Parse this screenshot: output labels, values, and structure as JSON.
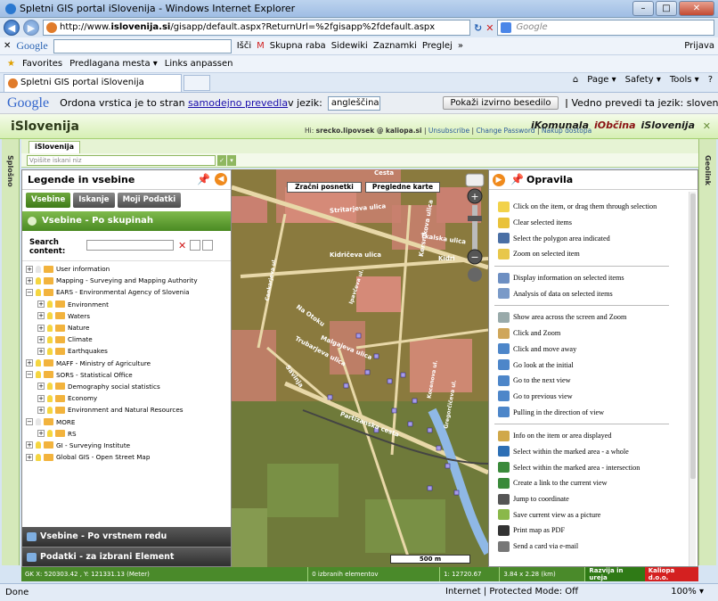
{
  "window": {
    "title": "Spletni GIS portal iSlovenija - Windows Internet Explorer"
  },
  "browser": {
    "address_prefix": "http://www.",
    "address_domain": "islovenija.si",
    "address_rest": "/gisapp/default.aspx?ReturnUrl=%2fgisapp%2fdefault.aspx",
    "search_placeholder": "Google",
    "google_label": "Google",
    "google_items": [
      "Išči",
      "M",
      "Skupna raba",
      "Sidewiki",
      "Zaznamki",
      "Preglej",
      "»",
      "Prijava"
    ],
    "favorites_label": "Favorites",
    "fav_items": [
      "Predlagana mesta ▾",
      "Links anpassen"
    ],
    "tab_label": "Spletni GIS portal iSlovenija",
    "cmd_items": [
      "Page ▾",
      "Safety ▾",
      "Tools ▾"
    ]
  },
  "translate": {
    "logo": "Google",
    "text_a": "Ordona vrstica je to stran ",
    "link": "samodejno prevedla",
    "text_b": " v jezik:",
    "language": "angleščina",
    "button": "Pokaži izvirno besedilo",
    "always": "Vedno prevedi ta jezik: slovenščina",
    "close": "✕"
  },
  "app": {
    "brand": "iSlovenija",
    "user_prefix": "Hi: ",
    "user": "srecko.lipovsek @ kaliopa.si",
    "unsubscribe": "Unsubscribe",
    "change_password": "Change Password",
    "buy": "Nakup dostopa",
    "logo1": "iKomunala",
    "logo2": "iObčina",
    "logo3": "iSlovenija",
    "left_sidebar": "Splošno",
    "right_sidebar": "Geolink",
    "app_tab": "iSlovenija",
    "search_placeholder": "Vpišite iskani niz"
  },
  "legend": {
    "title": "Legende in vsebine",
    "tabs": [
      "Vsebine",
      "Iskanje",
      "Moji Podatki"
    ],
    "group_bar": "Vsebine - Po skupinah",
    "search_label": "Search content:",
    "tree": [
      {
        "label": "User information",
        "level": 0,
        "pm": "+",
        "bulb": "off"
      },
      {
        "label": "Mapping - Surveying and Mapping Authority",
        "level": 0,
        "pm": "+",
        "bulb": "on"
      },
      {
        "label": "EARS - Environmental Agency of Slovenia",
        "level": 0,
        "pm": "−",
        "bulb": "on"
      },
      {
        "label": "Environment",
        "level": 1,
        "pm": "+",
        "bulb": "on"
      },
      {
        "label": "Waters",
        "level": 1,
        "pm": "+",
        "bulb": "on"
      },
      {
        "label": "Nature",
        "level": 1,
        "pm": "+",
        "bulb": "on"
      },
      {
        "label": "Climate",
        "level": 1,
        "pm": "+",
        "bulb": "on"
      },
      {
        "label": "Earthquakes",
        "level": 1,
        "pm": "+",
        "bulb": "on"
      },
      {
        "label": "MAFF - Ministry of Agriculture",
        "level": 0,
        "pm": "+",
        "bulb": "on"
      },
      {
        "label": "SORS - Statistical Office",
        "level": 0,
        "pm": "−",
        "bulb": "on"
      },
      {
        "label": "Demography social statistics",
        "level": 1,
        "pm": "+",
        "bulb": "on"
      },
      {
        "label": "Economy",
        "level": 1,
        "pm": "+",
        "bulb": "on"
      },
      {
        "label": "Environment and Natural Resources",
        "level": 1,
        "pm": "+",
        "bulb": "on"
      },
      {
        "label": "MORE",
        "level": 0,
        "pm": "−",
        "bulb": "off"
      },
      {
        "label": "RS",
        "level": 1,
        "pm": "+",
        "bulb": "on"
      },
      {
        "label": "GI - Surveying Institute",
        "level": 0,
        "pm": "+",
        "bulb": "on"
      },
      {
        "label": "Global GIS - Open Street Map",
        "level": 0,
        "pm": "+",
        "bulb": "on"
      }
    ],
    "bottom1": "Vsebine - Po vrstnem redu",
    "bottom2": "Podatki - za izbrani Element"
  },
  "map": {
    "btn_aerial": "Zračni posnetki",
    "btn_overview": "Pregledne karte",
    "scale": "500 m",
    "streets": [
      "Stritarjeva ulica",
      "Kidričeva ulica",
      "Tkalska ulica",
      "Kersnikova ulica",
      "Cesta",
      "Na Otoku",
      "Malgajeva ulica",
      "Trubarjeva ulica",
      "Partizanska cesta",
      "Savinja",
      "Kidri",
      "Ipavčeva ul.",
      "Cankarjeva ul.",
      "Gregorčičeva ul.",
      "Kocenova ul."
    ]
  },
  "tools": {
    "title": "Opravila",
    "groups": [
      [
        "Click on the item, or drag them through selection",
        "Clear selected items",
        "Select the polygon area indicated",
        "Zoom on selected item"
      ],
      [
        "Display information on selected items",
        "Analysis of data on selected items"
      ],
      [
        "Show area across the screen and Zoom",
        "Click and Zoom",
        "Click and move away",
        "Go look at the initial",
        "Go to the next view",
        "Go to previous view",
        "Pulling in the direction of view"
      ],
      [
        "Info on the item or area displayed",
        "Select within the marked area - a whole",
        "Select within the marked area - intersection",
        "Create a link to the current view",
        "Jump to coordinate",
        "Save current view as a picture",
        "Print map as PDF",
        "Send a card via e-mail"
      ]
    ]
  },
  "status": {
    "coords": "GK X: 520303.42 , Y: 121331.13 (Meter)",
    "selected": "0 izbranih elementov",
    "scale": "1: 12720.67",
    "size": "3.84 x 2.28 (km)",
    "dev": "Razvija in ureja",
    "company": "Kaliopa d.o.o."
  },
  "iestatus": {
    "left": "Done",
    "zone": "Internet | Protected Mode: Off",
    "zoom": "100% ▾"
  }
}
